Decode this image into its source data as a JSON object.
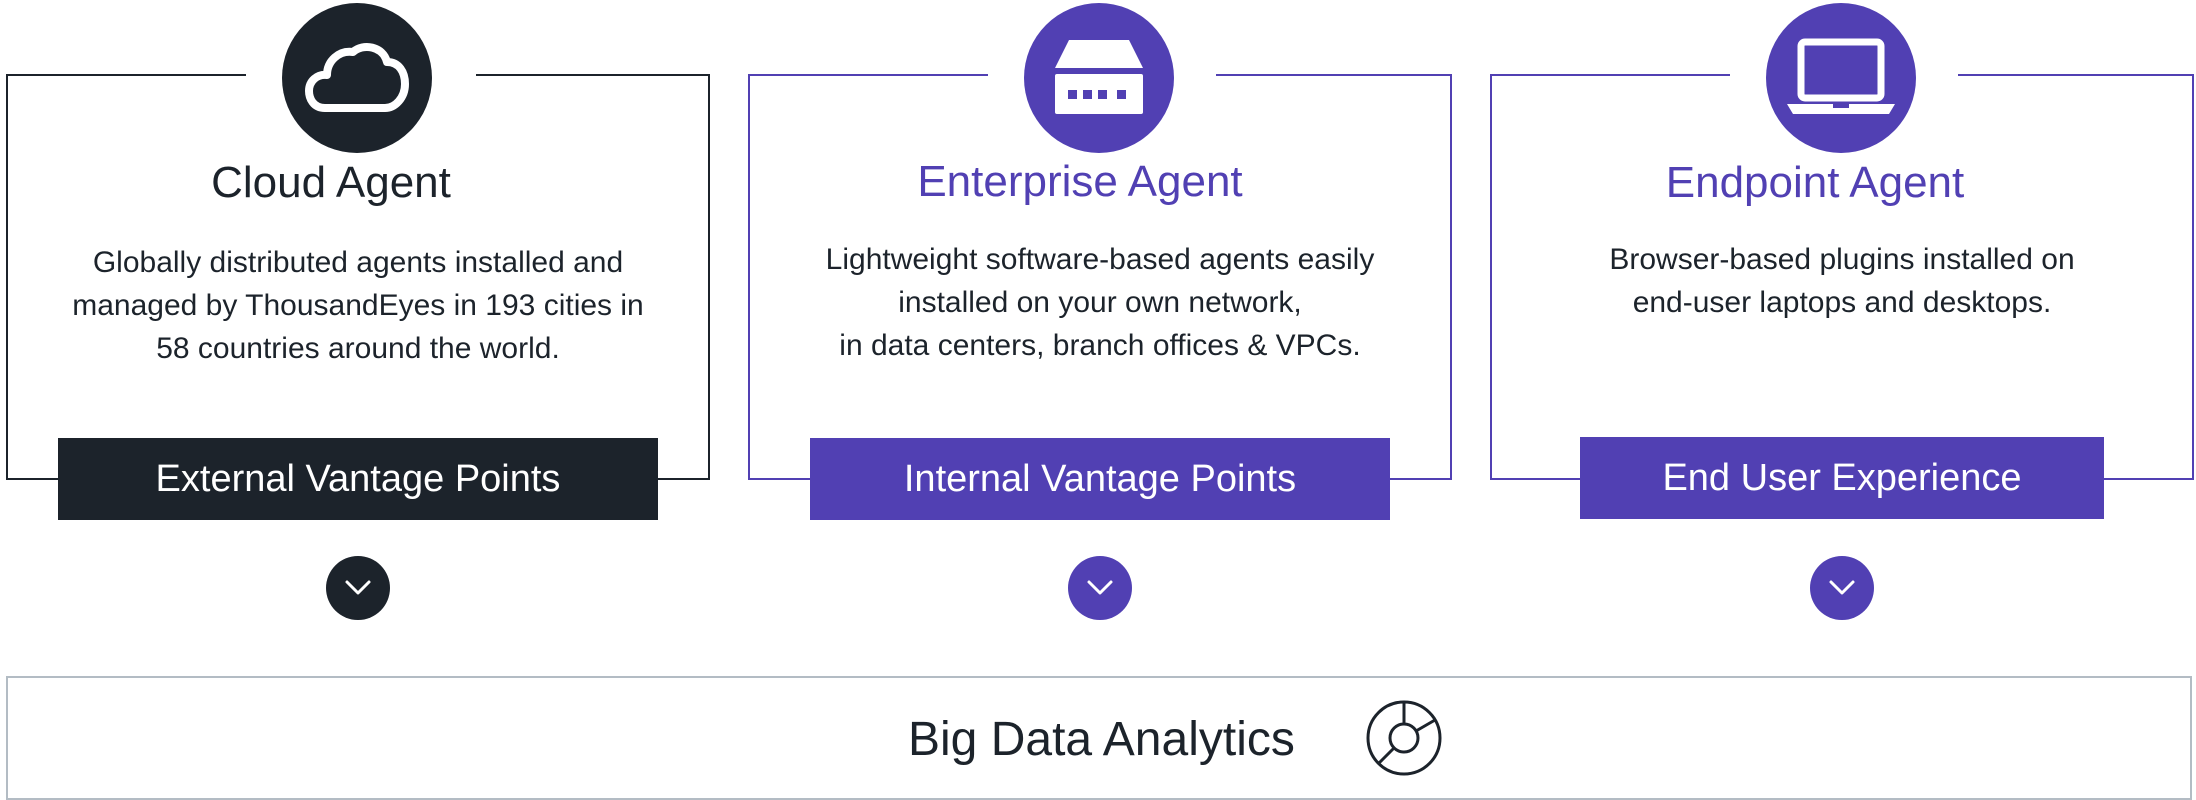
{
  "agents": [
    {
      "title": "Cloud Agent",
      "icon": "cloud-icon",
      "description": [
        "Globally distributed agents installed and",
        "managed by ThousandEyes in 193 cities in",
        "58 countries around the world."
      ],
      "banner": "External Vantage Points"
    },
    {
      "title": "Enterprise Agent",
      "icon": "server-appliance-icon",
      "description": [
        "Lightweight software-based agents easily",
        "installed on your own network,",
        "in data centers, branch offices & VPCs."
      ],
      "banner": "Internal Vantage Points"
    },
    {
      "title": "Endpoint Agent",
      "icon": "laptop-icon",
      "description": [
        "Browser-based plugins installed on",
        "end-user laptops and desktops."
      ],
      "banner": "End User Experience"
    }
  ],
  "analytics": {
    "label": "Big Data Analytics",
    "icon": "pie-chart-icon"
  },
  "colors": {
    "dark": "#1c232b",
    "accent": "#5140b3",
    "border_gray": "#b3bcc4"
  }
}
